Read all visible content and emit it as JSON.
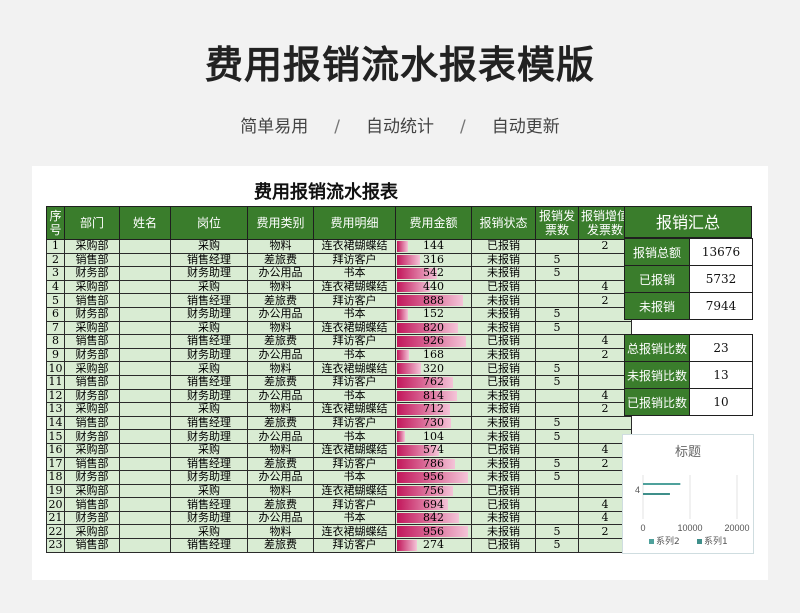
{
  "header": {
    "title": "费用报销流水报表模版",
    "subtitle_items": [
      "简单易用",
      "自动统计",
      "自动更新"
    ],
    "separator": "/"
  },
  "sheet": {
    "title": "费用报销流水报表",
    "columns": [
      "序号",
      "部门",
      "姓名",
      "岗位",
      "费用类别",
      "费用明细",
      "费用金额",
      "报销状态",
      "报销发票数",
      "报销增值发票数"
    ],
    "amount_max": 1000,
    "rows": [
      [
        "1",
        "采购部",
        "",
        "采购",
        "物料",
        "连衣裙蝴蝶结",
        "144",
        "已报销",
        "",
        "2"
      ],
      [
        "2",
        "销售部",
        "",
        "销售经理",
        "差旅费",
        "拜访客户",
        "316",
        "未报销",
        "5",
        ""
      ],
      [
        "3",
        "财务部",
        "",
        "财务助理",
        "办公用品",
        "书本",
        "542",
        "未报销",
        "5",
        ""
      ],
      [
        "4",
        "采购部",
        "",
        "采购",
        "物料",
        "连衣裙蝴蝶结",
        "440",
        "已报销",
        "",
        "4"
      ],
      [
        "5",
        "销售部",
        "",
        "销售经理",
        "差旅费",
        "拜访客户",
        "888",
        "未报销",
        "",
        "2"
      ],
      [
        "6",
        "财务部",
        "",
        "财务助理",
        "办公用品",
        "书本",
        "152",
        "未报销",
        "5",
        ""
      ],
      [
        "7",
        "采购部",
        "",
        "采购",
        "物料",
        "连衣裙蝴蝶结",
        "820",
        "未报销",
        "5",
        ""
      ],
      [
        "8",
        "销售部",
        "",
        "销售经理",
        "差旅费",
        "拜访客户",
        "926",
        "已报销",
        "",
        "4"
      ],
      [
        "9",
        "财务部",
        "",
        "财务助理",
        "办公用品",
        "书本",
        "168",
        "未报销",
        "",
        "2"
      ],
      [
        "10",
        "采购部",
        "",
        "采购",
        "物料",
        "连衣裙蝴蝶结",
        "320",
        "已报销",
        "5",
        ""
      ],
      [
        "11",
        "销售部",
        "",
        "销售经理",
        "差旅费",
        "拜访客户",
        "762",
        "已报销",
        "5",
        ""
      ],
      [
        "12",
        "财务部",
        "",
        "财务助理",
        "办公用品",
        "书本",
        "814",
        "未报销",
        "",
        "4"
      ],
      [
        "13",
        "采购部",
        "",
        "采购",
        "物料",
        "连衣裙蝴蝶结",
        "712",
        "未报销",
        "",
        "2"
      ],
      [
        "14",
        "销售部",
        "",
        "销售经理",
        "差旅费",
        "拜访客户",
        "730",
        "未报销",
        "5",
        ""
      ],
      [
        "15",
        "财务部",
        "",
        "财务助理",
        "办公用品",
        "书本",
        "104",
        "未报销",
        "5",
        ""
      ],
      [
        "16",
        "采购部",
        "",
        "采购",
        "物料",
        "连衣裙蝴蝶结",
        "574",
        "已报销",
        "",
        "4"
      ],
      [
        "17",
        "销售部",
        "",
        "销售经理",
        "差旅费",
        "拜访客户",
        "786",
        "未报销",
        "5",
        "2"
      ],
      [
        "18",
        "财务部",
        "",
        "财务助理",
        "办公用品",
        "书本",
        "956",
        "未报销",
        "5",
        ""
      ],
      [
        "19",
        "采购部",
        "",
        "采购",
        "物料",
        "连衣裙蝴蝶结",
        "756",
        "已报销",
        "",
        ""
      ],
      [
        "20",
        "销售部",
        "",
        "销售经理",
        "差旅费",
        "拜访客户",
        "694",
        "已报销",
        "",
        "4"
      ],
      [
        "21",
        "财务部",
        "",
        "财务助理",
        "办公用品",
        "书本",
        "842",
        "未报销",
        "",
        "4"
      ],
      [
        "22",
        "采购部",
        "",
        "采购",
        "物料",
        "连衣裙蝴蝶结",
        "956",
        "未报销",
        "5",
        "2"
      ],
      [
        "23",
        "销售部",
        "",
        "销售经理",
        "差旅费",
        "拜访客户",
        "274",
        "已报销",
        "5",
        ""
      ]
    ]
  },
  "summary": {
    "title": "报销汇总",
    "totals": [
      {
        "label": "报销总额",
        "value": "13676"
      },
      {
        "label": "已报销",
        "value": "5732"
      },
      {
        "label": "未报销",
        "value": "7944"
      }
    ],
    "counts": [
      {
        "label": "总报销比数",
        "value": "23"
      },
      {
        "label": "未报销比数",
        "value": "13"
      },
      {
        "label": "已报销比数",
        "value": "10"
      }
    ]
  },
  "chart_data": {
    "type": "bar",
    "title": "标题",
    "categories": [
      "4"
    ],
    "series": [
      {
        "name": "系列2",
        "values": [
          7944
        ]
      },
      {
        "name": "系列1",
        "values": [
          5732
        ]
      }
    ],
    "xticks": [
      "0",
      "10000",
      "20000"
    ],
    "xlim": [
      0,
      20000
    ],
    "legend": "bottom",
    "colors": {
      "series2": "#4fa19c",
      "series1": "#3f8f8a"
    }
  }
}
